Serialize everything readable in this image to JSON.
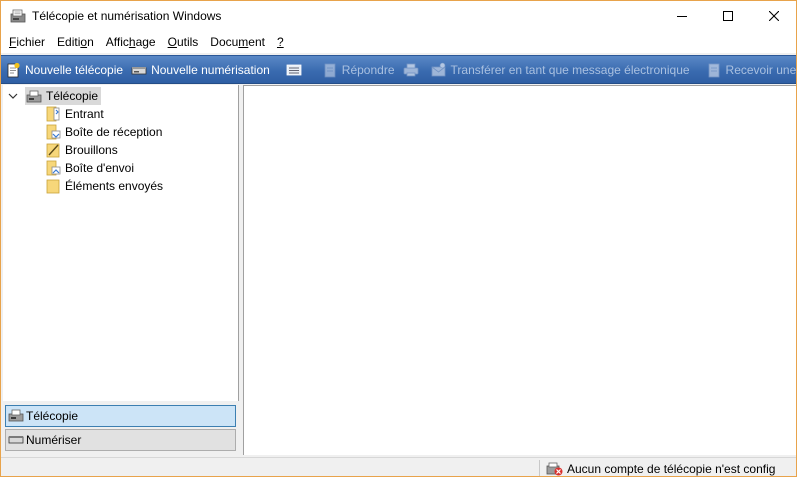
{
  "window": {
    "title": "Télécopie et numérisation Windows",
    "controls": [
      "minimize",
      "maximize",
      "close"
    ]
  },
  "menubar": {
    "items": [
      {
        "pre": "",
        "u": "F",
        "post": "ichier"
      },
      {
        "pre": "Editi",
        "u": "o",
        "post": "n"
      },
      {
        "pre": "Affic",
        "u": "h",
        "post": "age"
      },
      {
        "pre": "",
        "u": "O",
        "post": "utils"
      },
      {
        "pre": "Docu",
        "u": "m",
        "post": "ent"
      },
      {
        "pre": "",
        "u": "?",
        "post": ""
      }
    ]
  },
  "toolbar": {
    "new_fax": "Nouvelle télécopie",
    "new_scan": "Nouvelle numérisation",
    "reply": "Répondre",
    "forward_email": "Transférer en tant que message électronique",
    "receive": "Recevoir une t"
  },
  "tree": {
    "root": "Télécopie",
    "children": [
      {
        "label": "Entrant",
        "icon": "incoming-folder-icon"
      },
      {
        "label": "Boîte de réception",
        "icon": "inbox-folder-icon"
      },
      {
        "label": "Brouillons",
        "icon": "drafts-folder-icon"
      },
      {
        "label": "Boîte d'envoi",
        "icon": "outbox-folder-icon"
      },
      {
        "label": "Éléments envoyés",
        "icon": "sent-folder-icon"
      }
    ]
  },
  "nav": {
    "fax": "Télécopie",
    "scan": "Numériser"
  },
  "status": {
    "message": "Aucun compte de télécopie n'est config"
  },
  "colors": {
    "toolbar": "#3a6bb0",
    "window_border": "#e8a34b",
    "selection": "#cce4f7"
  }
}
